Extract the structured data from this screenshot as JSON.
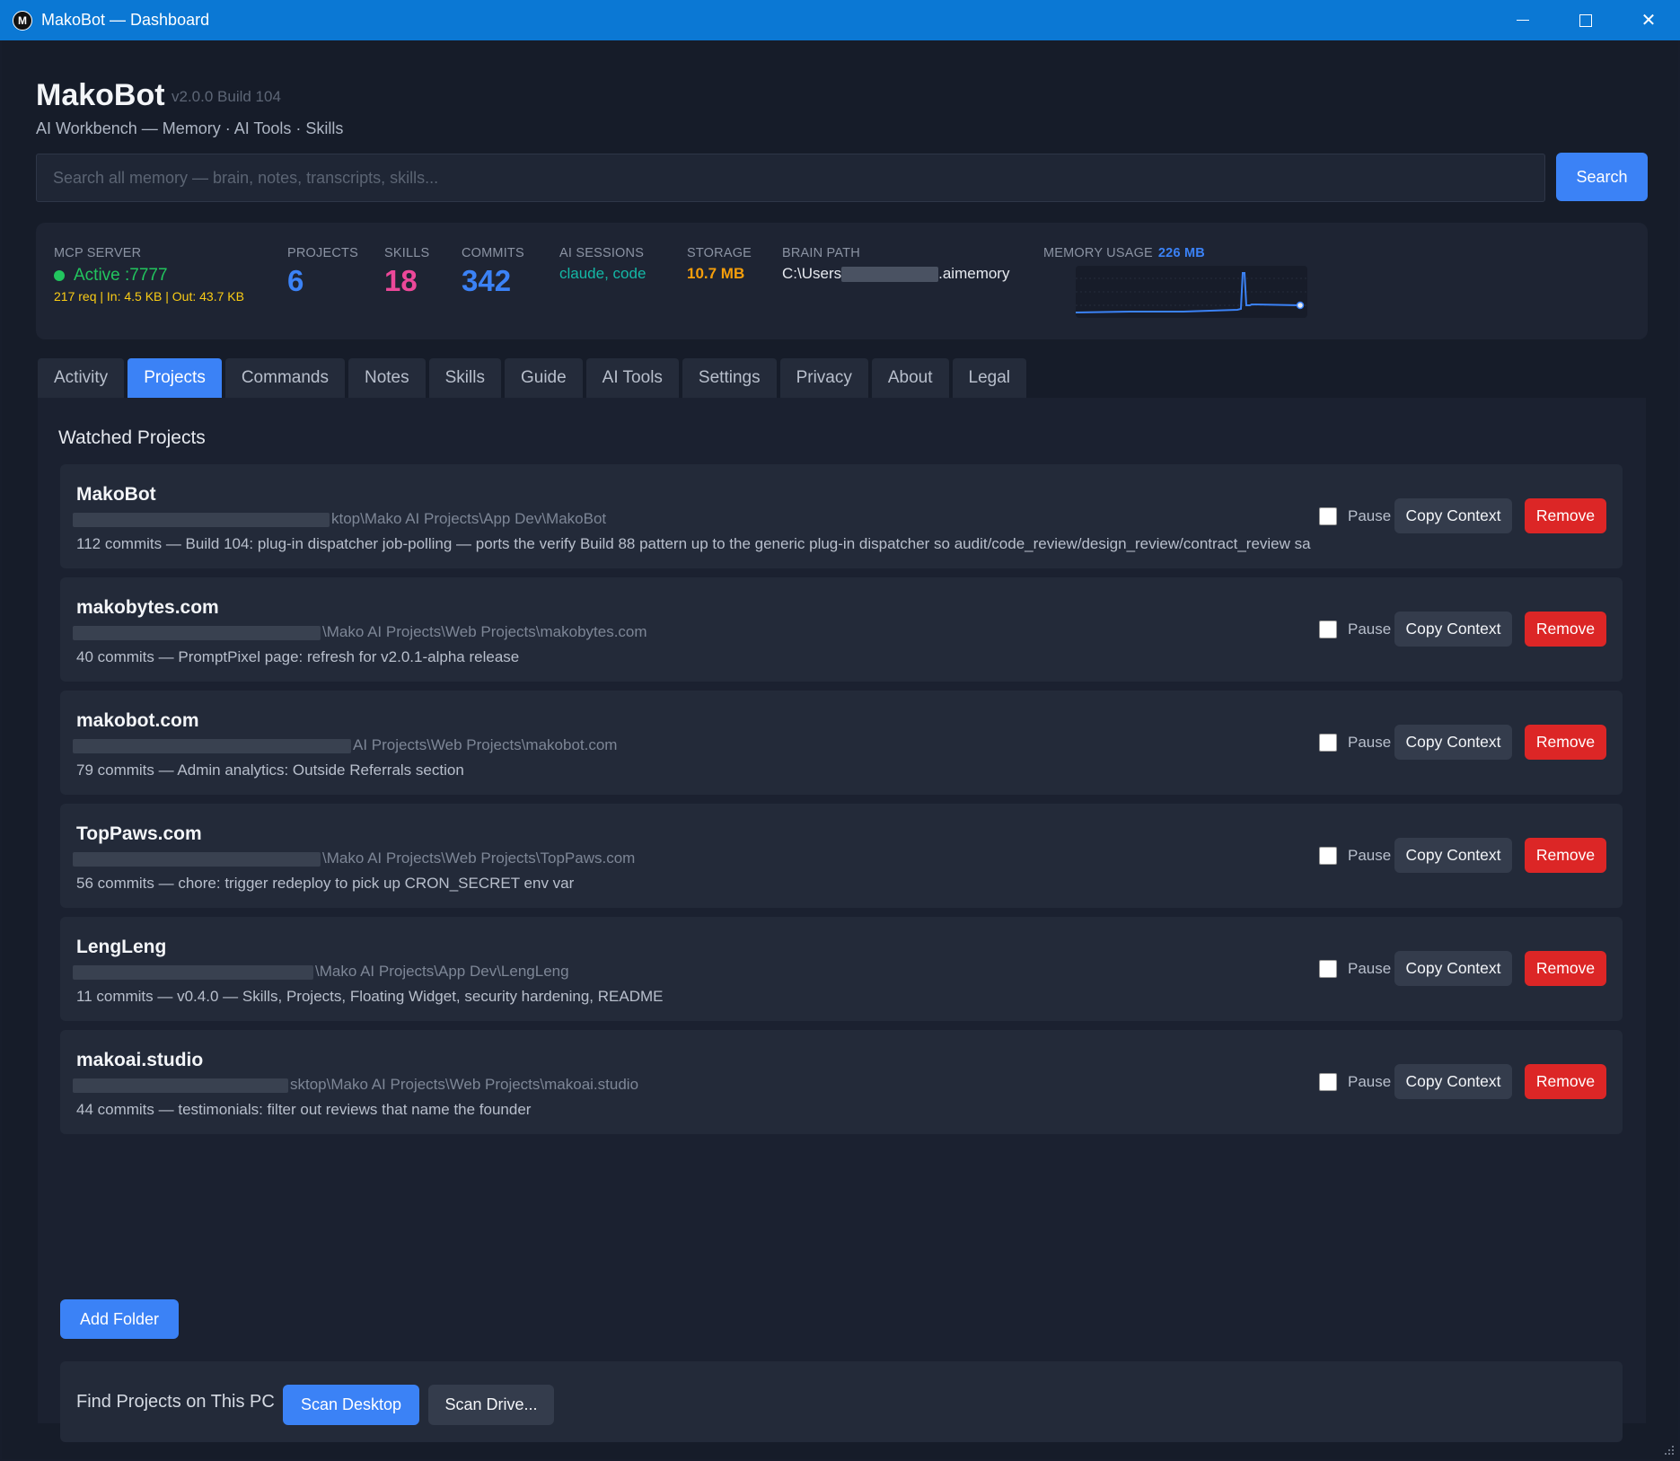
{
  "window": {
    "logo": "M",
    "title": "MakoBot — Dashboard",
    "minimize_icon": "minimize-icon",
    "maximize_icon": "maximize-icon",
    "close_icon": "close-icon",
    "close_glyph": "✕"
  },
  "header": {
    "title": "MakoBot",
    "version": "v2.0.0 Build 104",
    "subtitle": "AI Workbench — Memory · AI Tools · Skills"
  },
  "search": {
    "placeholder": "Search all memory — brain, notes, transcripts, skills...",
    "value": "",
    "button_label": "Search"
  },
  "stats": {
    "mcp_server": {
      "label": "MCP SERVER",
      "status": "Active :7777",
      "traffic": "217 req | In: 4.5 KB | Out: 43.7 KB",
      "color": "#22c55e"
    },
    "projects": {
      "label": "PROJECTS",
      "value": "6",
      "color": "#3b82f6"
    },
    "skills": {
      "label": "SKILLS",
      "value": "18",
      "color": "#ec4899"
    },
    "commits": {
      "label": "COMMITS",
      "value": "342",
      "color": "#3b82f6"
    },
    "ai_sessions": {
      "label": "AI SESSIONS",
      "value": "claude, code",
      "color": "#14b8a6"
    },
    "storage": {
      "label": "STORAGE",
      "value": "10.7 MB",
      "color": "#f59e0b"
    },
    "brain_path": {
      "label": "BRAIN PATH",
      "prefix": "C:\\Users",
      "suffix": ".aimemory"
    },
    "memory_usage": {
      "label": "MEMORY USAGE",
      "value": "226 MB",
      "color": "#3b82f6"
    }
  },
  "tabs": [
    {
      "label": "Activity",
      "active": false
    },
    {
      "label": "Projects",
      "active": true
    },
    {
      "label": "Commands",
      "active": false
    },
    {
      "label": "Notes",
      "active": false
    },
    {
      "label": "Skills",
      "active": false
    },
    {
      "label": "Guide",
      "active": false
    },
    {
      "label": "AI Tools",
      "active": false
    },
    {
      "label": "Settings",
      "active": false
    },
    {
      "label": "Privacy",
      "active": false
    },
    {
      "label": "About",
      "active": false
    },
    {
      "label": "Legal",
      "active": false
    }
  ],
  "projects_panel": {
    "title": "Watched Projects",
    "pause_label": "Pause",
    "copy_label": "Copy Context",
    "remove_label": "Remove",
    "items": [
      {
        "name": "MakoBot",
        "path": "ktop\\Mako AI Projects\\App Dev\\MakoBot",
        "info": "112 commits  —  Build 104: plug-in dispatcher job-polling — ports the verify Build 88 pattern up to the generic plug-in dispatcher so audit/code_review/design_review/contract_review sa"
      },
      {
        "name": "makobytes.com",
        "path": "\\Mako AI Projects\\Web Projects\\makobytes.com",
        "info": "40 commits  —  PromptPixel page: refresh for v2.0.1-alpha release"
      },
      {
        "name": "makobot.com",
        "path": "AI Projects\\Web Projects\\makobot.com",
        "info": "79 commits  —  Admin analytics: Outside Referrals section"
      },
      {
        "name": "TopPaws.com",
        "path": "\\Mako AI Projects\\Web Projects\\TopPaws.com",
        "info": "56 commits  —  chore: trigger redeploy to pick up CRON_SECRET env var"
      },
      {
        "name": "LengLeng",
        "path": "\\Mako AI Projects\\App Dev\\LengLeng",
        "info": "11 commits  —  v0.4.0 — Skills, Projects, Floating Widget, security hardening, README"
      },
      {
        "name": "makoai.studio",
        "path": "sktop\\Mako AI Projects\\Web Projects\\makoai.studio",
        "info": "44 commits  —  testimonials: filter out reviews that name the founder"
      }
    ],
    "add_folder_label": "Add Folder",
    "find_label": "Find Projects on This PC",
    "scan_desktop_label": "Scan Desktop",
    "scan_drive_label": "Scan Drive..."
  }
}
